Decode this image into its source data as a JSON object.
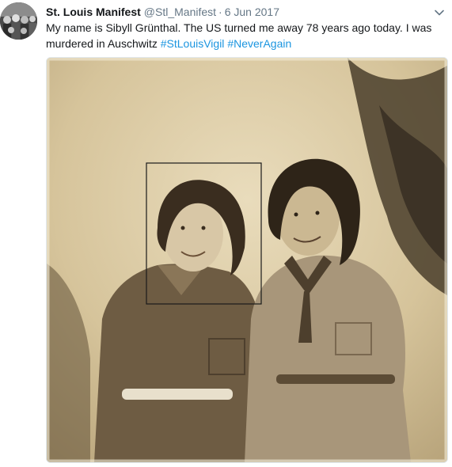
{
  "tweet": {
    "display_name": "St. Louis Manifest",
    "handle": "@Stl_Manifest",
    "separator": "·",
    "date": "6 Jun 2017",
    "text_main": "My name is Sibyll Grünthal. The US turned me away 78 years ago today. I was murdered in Auschwitz ",
    "hashtags": [
      "#StLouisVigil",
      "#NeverAgain"
    ],
    "avatar_icon": "group-photo-avatar",
    "menu_icon": "chevron-down-icon",
    "media": {
      "description_icon": "vintage-photo-two-young-women",
      "tone": "sepia"
    }
  },
  "colors": {
    "text": "#14171a",
    "secondary": "#657786",
    "link": "#1b95e0",
    "photo_base": "#d9c9a3"
  }
}
